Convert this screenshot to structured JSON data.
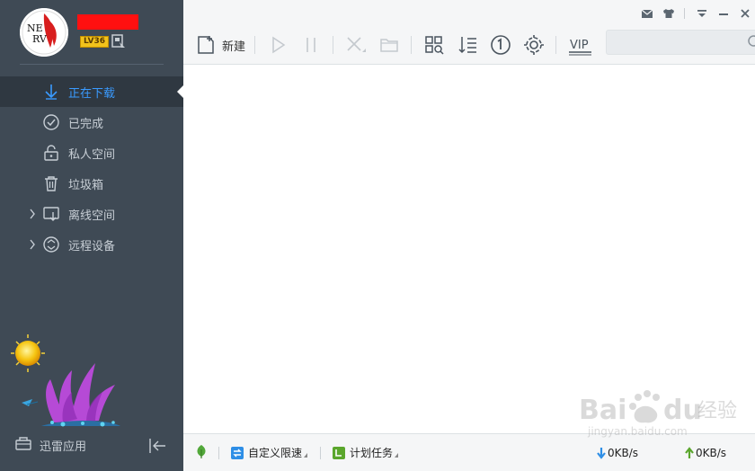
{
  "sidebar": {
    "level": "LV36",
    "nav": [
      {
        "label": "正在下载",
        "icon": "download-arrow-icon",
        "active": true
      },
      {
        "label": "已完成",
        "icon": "check-circle-icon"
      },
      {
        "label": "私人空间",
        "icon": "lock-icon"
      },
      {
        "label": "垃圾箱",
        "icon": "trash-icon"
      },
      {
        "label": "离线空间",
        "icon": "cloud-download-icon",
        "expandable": true
      },
      {
        "label": "远程设备",
        "icon": "remote-device-icon",
        "expandable": true
      }
    ],
    "apps_label": "迅雷应用"
  },
  "toolbar": {
    "new_label": "新建",
    "vip_label": "VIP"
  },
  "search": {
    "placeholder": ""
  },
  "status": {
    "speed_limit_label": "自定义限速",
    "schedule_label": "计划任务",
    "download_speed": "0KB/s",
    "upload_speed": "0KB/s"
  },
  "colors": {
    "accent": "#3a9bff",
    "sidebar_bg": "#3f4a55",
    "sidebar_active_bg": "#2f3841"
  }
}
